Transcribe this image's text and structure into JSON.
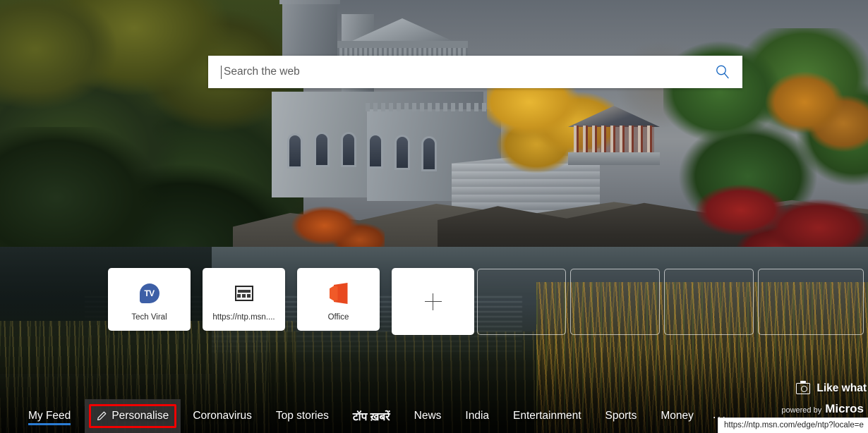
{
  "search": {
    "placeholder": "Search the web",
    "icon": "search-icon",
    "value": ""
  },
  "tiles": [
    {
      "label": "Tech Viral",
      "icon": "tv-logo-icon",
      "icon_text": "TV"
    },
    {
      "label": "https://ntp.msn....",
      "icon": "generic-page-icon"
    },
    {
      "label": "Office",
      "icon": "office-logo-icon"
    }
  ],
  "add_tile": {
    "label": "+",
    "icon": "plus-icon"
  },
  "empty_tiles_count": 4,
  "like_badge": {
    "icon": "camera-icon",
    "text": "Like what"
  },
  "bottom_nav": {
    "items": [
      {
        "label": "My Feed",
        "active": true,
        "underline": true
      },
      {
        "label": "Personalise",
        "icon": "pencil-icon",
        "hovered": true,
        "highlighted": true
      },
      {
        "label": "Coronavirus"
      },
      {
        "label": "Top stories"
      },
      {
        "label": "टॉप ख़बरें",
        "bold": true
      },
      {
        "label": "News"
      },
      {
        "label": "India"
      },
      {
        "label": "Entertainment"
      },
      {
        "label": "Sports"
      },
      {
        "label": "Money"
      }
    ],
    "overflow": "...",
    "powered_by": {
      "prefix": "powered by",
      "brand": "Micros"
    }
  },
  "status_tooltip": {
    "url": "https://ntp.msn.com/edge/ntp?locale=e"
  },
  "colors": {
    "accent_blue": "#2b7cd3",
    "search_icon_blue": "#1565c0",
    "highlight_red": "#f00000",
    "office_orange": "#e8491f",
    "tv_blue": "#3d5fa6",
    "tile_white": "#ffffff"
  }
}
